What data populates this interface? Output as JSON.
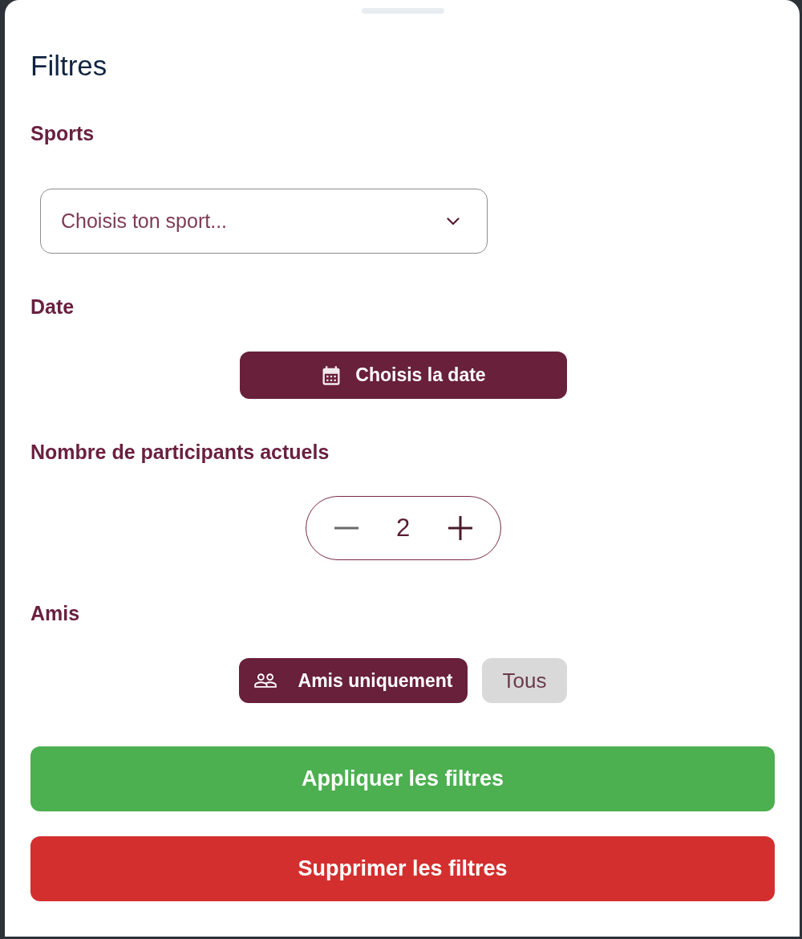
{
  "sheet": {
    "title": "Filtres"
  },
  "sections": [
    {
      "kind": "select",
      "label": "Sports",
      "placeholder": "Choisis ton sport..."
    },
    {
      "kind": "date",
      "label": "Date",
      "button": "Choisis la date"
    },
    {
      "kind": "stepper",
      "label": "Nombre de participants actuels",
      "value": "2"
    },
    {
      "kind": "toggle",
      "label": "Amis",
      "options": [
        {
          "kind": "friends",
          "label": "Amis uniquement",
          "selected": true
        },
        {
          "kind": "all",
          "label": "Tous",
          "selected": false
        }
      ]
    }
  ],
  "actions": [
    {
      "kind": "apply",
      "label": "Appliquer les filtres"
    },
    {
      "kind": "clear",
      "label": "Supprimer les filtres"
    }
  ]
}
